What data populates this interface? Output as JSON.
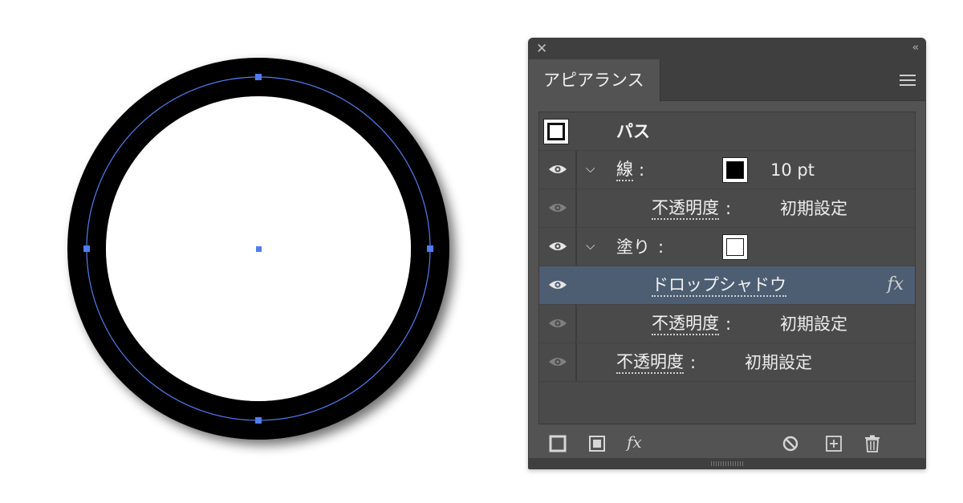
{
  "panel": {
    "tab_title": "アピアランス",
    "close_glyph": "✕",
    "collapse_glyph": "‹‹"
  },
  "rows": {
    "path": {
      "label": "パス"
    },
    "stroke": {
      "label": "線",
      "colon": ":",
      "value": "10 pt"
    },
    "stroke_opacity": {
      "label": "不透明度",
      "colon": ":",
      "value": "初期設定"
    },
    "fill": {
      "label": "塗り",
      "colon": ":"
    },
    "drop_shadow": {
      "label": "ドロップシャドウ",
      "fx": "fx"
    },
    "fill_opacity": {
      "label": "不透明度",
      "colon": ":",
      "value": "初期設定"
    },
    "opacity": {
      "label": "不透明度",
      "colon": ":",
      "value": "初期設定"
    }
  },
  "colors": {
    "selection_anchor": "#4f7df2",
    "selected_row": "#4d5e73",
    "panel_bg": "#535353"
  },
  "footer": {
    "fx_label": "fx",
    "icons": [
      "add-new-stroke-icon",
      "add-new-fill-icon",
      "add-effect-icon",
      "clear-appearance-icon",
      "duplicate-item-icon",
      "delete-item-icon"
    ]
  }
}
